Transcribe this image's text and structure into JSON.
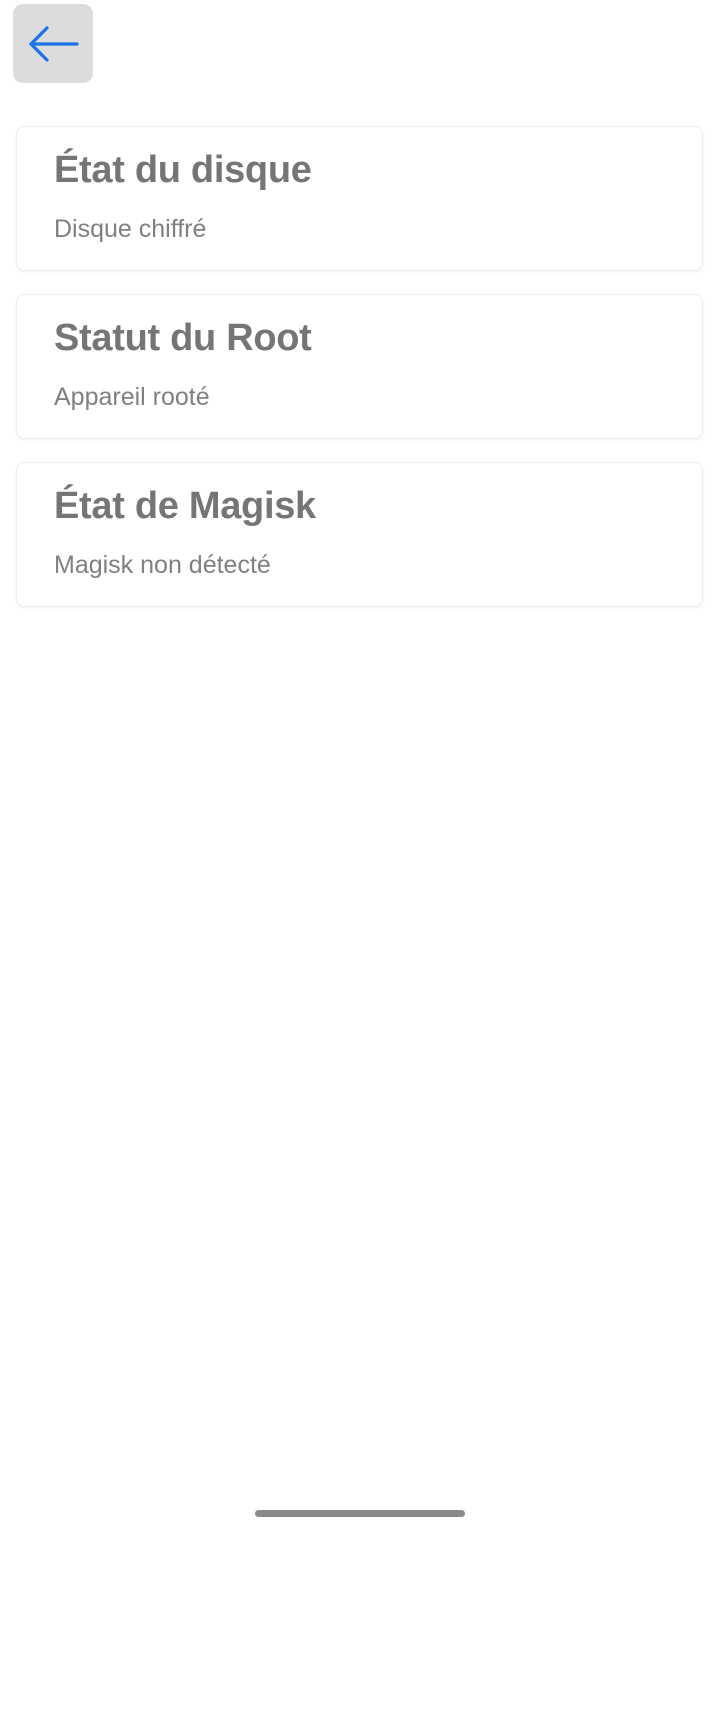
{
  "header": {
    "back_icon": "arrow-left-icon",
    "accent_color": "#1a73e8"
  },
  "cards": [
    {
      "title": "État du disque",
      "subtitle": "Disque chiffré"
    },
    {
      "title": "Statut du Root",
      "subtitle": "Appareil rooté"
    },
    {
      "title": "État de Magisk",
      "subtitle": "Magisk non détecté"
    }
  ],
  "colors": {
    "title": "#757575",
    "subtitle": "#808080",
    "button_bg": "#dcdcdc"
  }
}
